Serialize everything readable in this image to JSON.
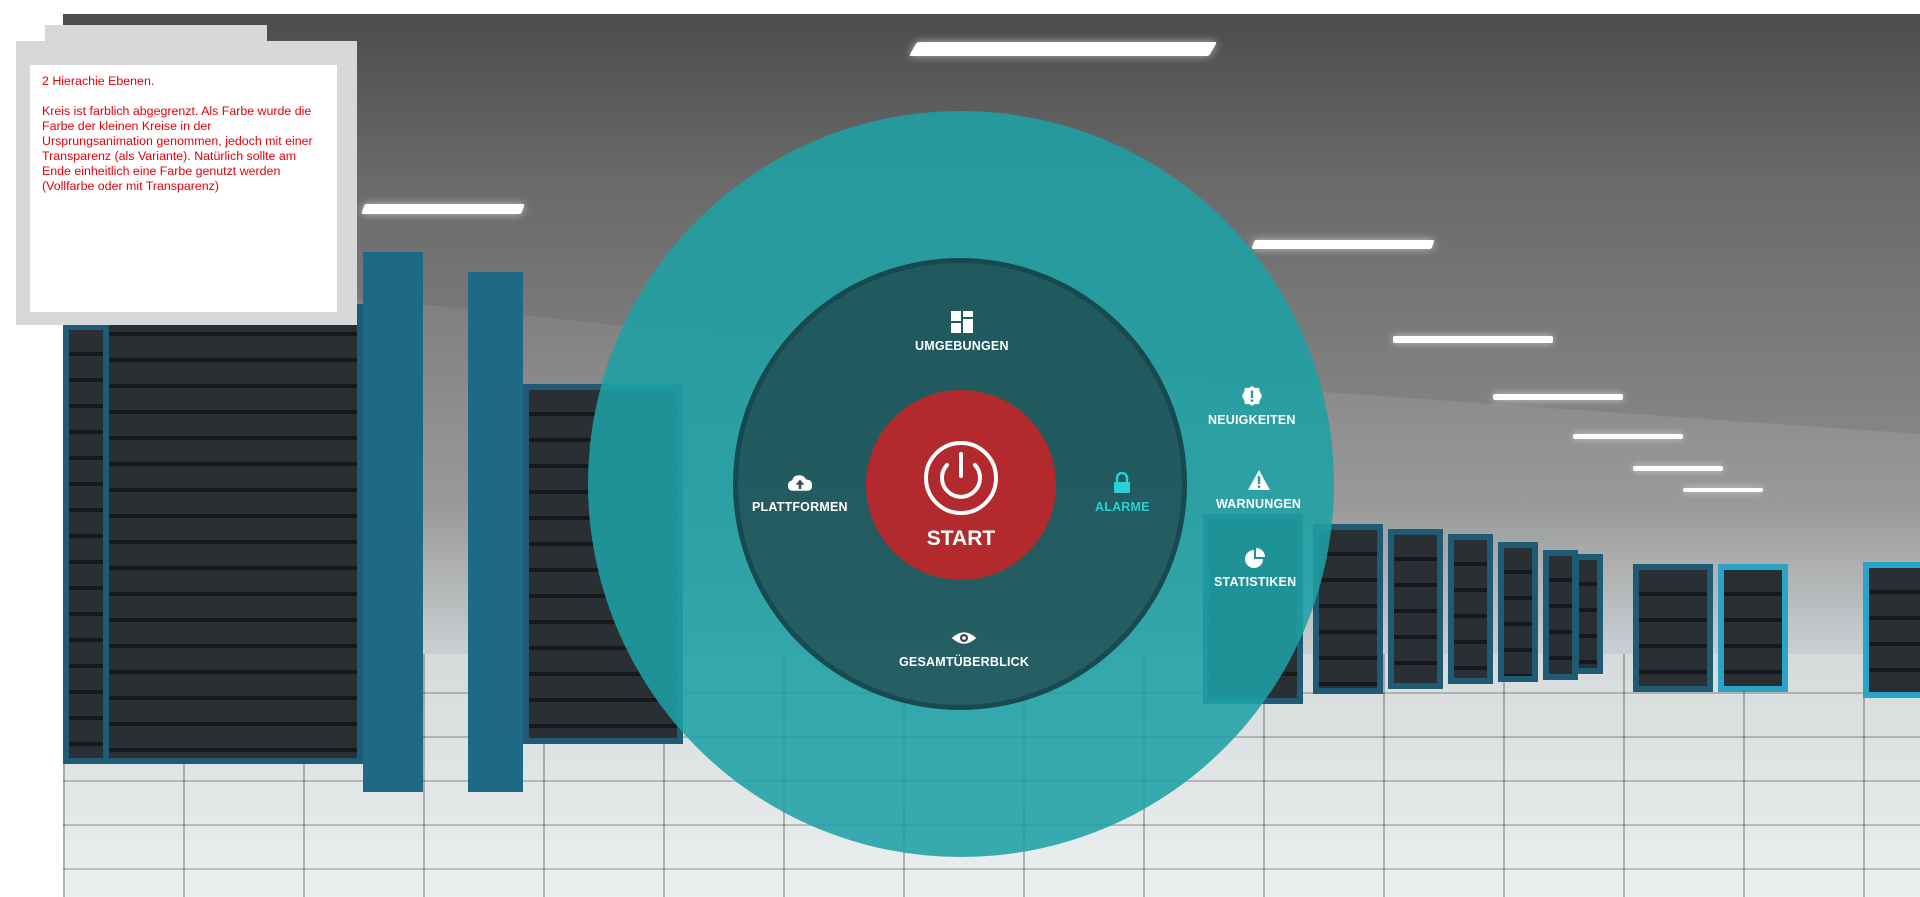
{
  "note": {
    "heading": "2 Hierachie Ebenen.",
    "body": "Kreis ist farblich abgegrenzt. Als Farbe wurde die Farbe der kleinen Kreise in der Ursprungsanimation genommen, jedoch mit einer Transparenz (als Variante). Natürlich sollte am Ende einheitlich eine Farbe genutzt werden (Vollfarbe oder mit Transparenz)"
  },
  "menu": {
    "center": {
      "label": "START",
      "icon": "power-icon"
    },
    "inner_items": [
      {
        "id": "umgebungen",
        "label": "UMGEBUNGEN",
        "icon": "grid-icon"
      },
      {
        "id": "plattformen",
        "label": "PLATTFORMEN",
        "icon": "cloud-upload-icon"
      },
      {
        "id": "alarme",
        "label": "ALARME",
        "icon": "lock-icon",
        "active": true
      },
      {
        "id": "gesamtuberblick",
        "label": "GESAMTÜBERBLICK",
        "icon": "eye-icon"
      }
    ],
    "outer_items": [
      {
        "id": "neuigkeiten",
        "label": "NEUIGKEITEN",
        "icon": "alert-badge-icon"
      },
      {
        "id": "warnungen",
        "label": "WARNUNGEN",
        "icon": "warning-triangle-icon"
      },
      {
        "id": "statistiken",
        "label": "STATISTIKEN",
        "icon": "pie-chart-icon"
      }
    ]
  },
  "colors": {
    "outer_ring": "#1ea0a5",
    "core": "#d21e23",
    "active_item": "#2bd0d4",
    "note_text": "#e3000b"
  }
}
